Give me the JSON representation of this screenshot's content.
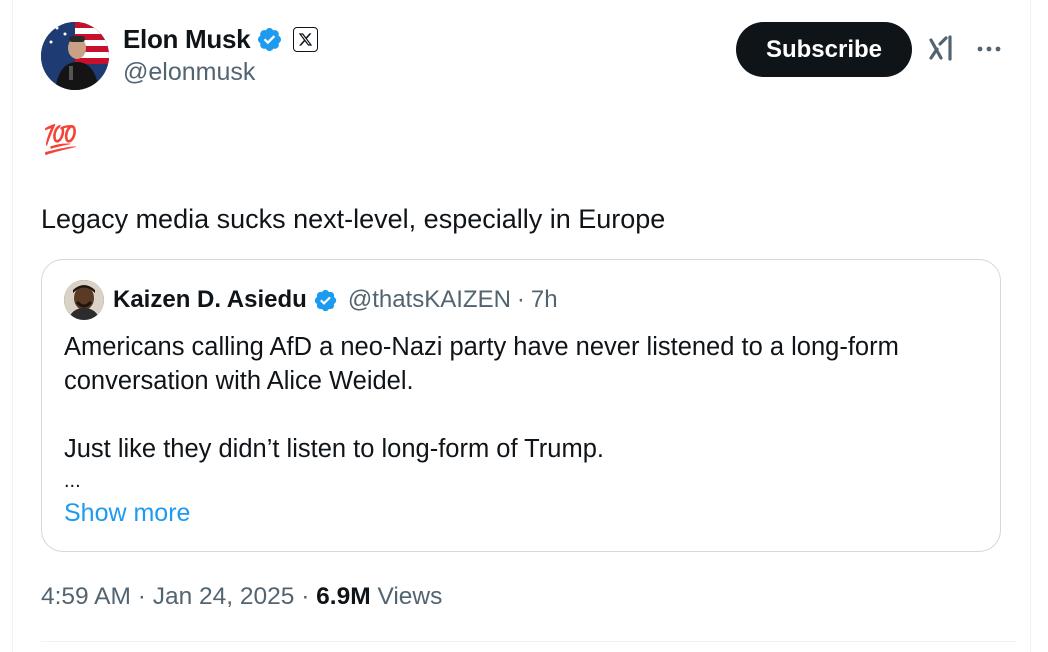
{
  "author": {
    "name": "Elon Musk",
    "handle": "@elonmusk",
    "verified": true,
    "affiliate_badge": "x-logo-icon"
  },
  "actions": {
    "subscribe_label": "Subscribe",
    "grok_icon": "grok-icon",
    "more_icon": "more-icon"
  },
  "tweet": {
    "emoji": "💯",
    "text": "Legacy media sucks next-level, especially in Europe"
  },
  "quote": {
    "name": "Kaizen D. Asiedu",
    "handle": "@thatsKAIZEN",
    "separator": "·",
    "time": "7h",
    "verified": true,
    "line1": "Americans calling AfD a neo-Nazi party have never listened to a long-form",
    "line2": "conversation with Alice Weidel.",
    "line3": "Just like they didn’t listen to long-form of Trump.",
    "ellipsis": "...",
    "show_more": "Show more"
  },
  "meta": {
    "time": "4:59 AM",
    "sep1": "·",
    "date": "Jan 24, 2025",
    "sep2": "·",
    "views_count": "6.9M",
    "views_label": "Views"
  },
  "colors": {
    "text": "#0f1419",
    "secondary": "#536471",
    "link": "#1d9bf0",
    "border": "#cfd9de",
    "verified": "#1d9bf0"
  }
}
